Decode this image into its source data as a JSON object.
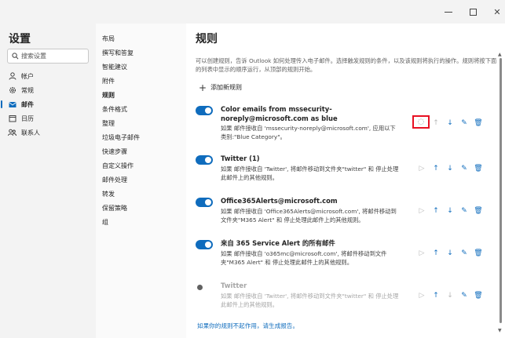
{
  "settings": {
    "title": "设置",
    "search_placeholder": "搜索设置",
    "categories": [
      {
        "label": "帐户",
        "icon": "person-icon"
      },
      {
        "label": "常规",
        "icon": "gear-icon"
      },
      {
        "label": "邮件",
        "icon": "mail-icon"
      },
      {
        "label": "日历",
        "icon": "calendar-icon"
      },
      {
        "label": "联系人",
        "icon": "people-icon"
      }
    ],
    "active_category": "邮件"
  },
  "nav": {
    "items": [
      "布局",
      "撰写和答复",
      "智能建议",
      "附件",
      "规则",
      "条件格式",
      "整理",
      "垃圾电子邮件",
      "快速步骤",
      "自定义操作",
      "邮件处理",
      "转发",
      "保留策略",
      "组"
    ],
    "active": "规则"
  },
  "main": {
    "title": "规则",
    "description": "可以创建规则，告诉 Outlook 如何处理传入电子邮件。选择触发规则的条件，以及该规则将执行的操作。规则将按下面的列表中显示的顺序运行，从顶部的规则开始。",
    "add_rule_label": "添加新规则",
    "report_link": "如果你的规则不起作用，请生成报告。"
  },
  "rules": [
    {
      "name": "Color emails from mssecurity-noreply@microsoft.com as blue",
      "description": "如果 邮件接收自 'mssecurity-noreply@microsoft.com', 应用以下类别:\"Blue Category\"。",
      "enabled": true
    },
    {
      "name": "Twitter (1)",
      "description": "如果 邮件接收自 'Twitter', 将邮件移动到文件夹\"twitter\" 和 停止处理此邮件上的其他规则。",
      "enabled": true
    },
    {
      "name": "Office365Alerts@microsoft.com",
      "description": "如果 邮件接收自 'Office365Alerts@microsoft.com', 将邮件移动到文件夹\"M365 Alert\" 和 停止处理此邮件上的其他规则。",
      "enabled": true
    },
    {
      "name": "来自 365 Service Alert 的所有邮件",
      "description": "如果 邮件接收自 'o365mc@microsoft.com', 将邮件移动到文件夹\"M365 Alert\" 和 停止处理此邮件上的其他规则。",
      "enabled": true
    },
    {
      "name": "Twitter",
      "description": "如果 邮件接收自 'Twitter', 将邮件移动到文件夹\"twitter\" 和 停止处理此邮件上的其他规则。",
      "enabled": false
    }
  ],
  "colors": {
    "accent": "#0f6cbd",
    "highlight": "#e81123"
  }
}
